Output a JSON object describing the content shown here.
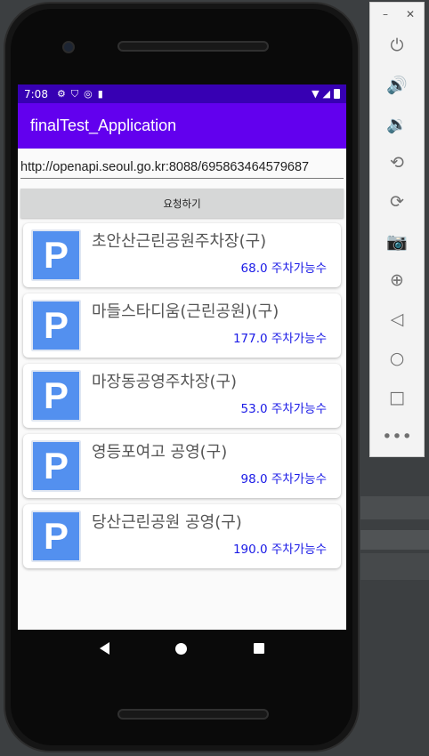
{
  "statusbar": {
    "time": "7:08"
  },
  "app": {
    "title": "finalTest_Application"
  },
  "url_field": {
    "value": "http://openapi.seoul.go.kr:8088/695863464579687"
  },
  "request_button": {
    "label": "요청하기"
  },
  "parking_list": [
    {
      "name": "초안산근린공원주차장(구)",
      "count": "68.0 주차가능수",
      "icon": "P"
    },
    {
      "name": "마들스타디움(근린공원)(구)",
      "count": "177.0 주차가능수",
      "icon": "P"
    },
    {
      "name": "마장동공영주차장(구)",
      "count": "53.0 주차가능수",
      "icon": "P"
    },
    {
      "name": "영등포여고 공영(구)",
      "count": "98.0 주차가능수",
      "icon": "P"
    },
    {
      "name": "당산근린공원 공영(구)",
      "count": "190.0 주차가능수",
      "icon": "P"
    }
  ],
  "emulator": {
    "minimize": "–",
    "close": "✕",
    "buttons": [
      "power-icon",
      "volume-up-icon",
      "volume-down-icon",
      "rotate-left-icon",
      "rotate-right-icon",
      "camera-icon",
      "zoom-icon",
      "back-icon",
      "home-icon",
      "overview-icon",
      "more-icon"
    ]
  },
  "colors": {
    "statusbar": "#3700b3",
    "appbar": "#6200ee",
    "count_text": "#1a1ae6",
    "parking_icon": "#5390ef"
  }
}
